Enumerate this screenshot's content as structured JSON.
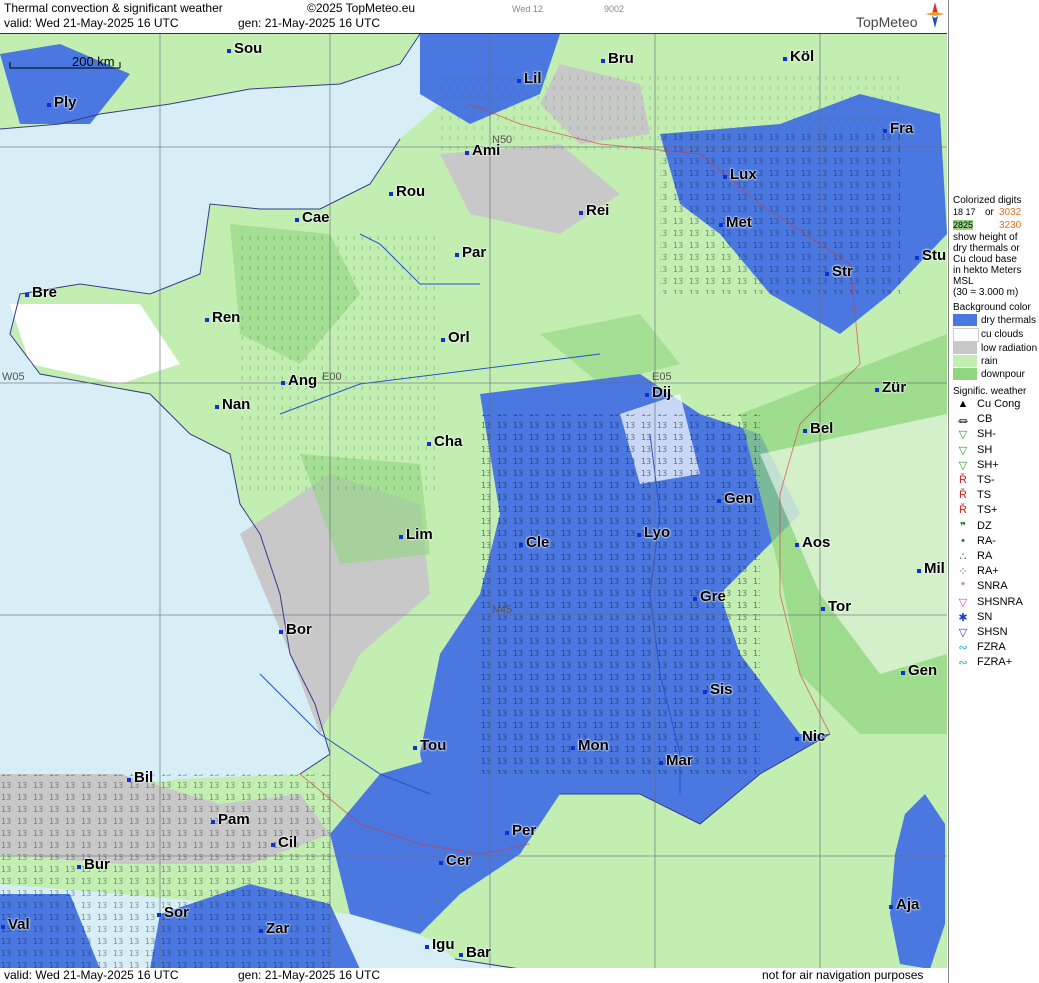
{
  "header": {
    "title": "Thermal convection & significant weather",
    "copyright": "©2025 TopMeteo.eu",
    "valid": "valid:  Wed  21-May-2025  16 UTC",
    "gen": "gen: 21-May-2025 16 UTC",
    "run": "Wed 12",
    "code": "9002",
    "logo": "TopMeteo"
  },
  "footer": {
    "valid": "valid:  Wed  21-May-2025  16 UTC",
    "gen": "gen: 21-May-2025 16 UTC",
    "disclaimer": "not for air navigation purposes"
  },
  "map": {
    "scale": "200 km",
    "grid_labels": [
      "W05",
      "E00",
      "E05",
      "N50",
      "N45"
    ],
    "cities": [
      "Sou",
      "Bru",
      "Köl",
      "Lil",
      "Ply",
      "Ami",
      "Fra",
      "Lux",
      "Rou",
      "Rei",
      "Cae",
      "Met",
      "Par",
      "Stu",
      "Str",
      "Bre",
      "Ren",
      "Orl",
      "Zür",
      "Ang",
      "Dij",
      "Nan",
      "Bel",
      "Cha",
      "Gen",
      "Lim",
      "Lyo",
      "Cle",
      "Aos",
      "Mil",
      "Gre",
      "Tor",
      "Bor",
      "Gen",
      "Sis",
      "Nic",
      "Tou",
      "Mon",
      "Mar",
      "Bil",
      "Pam",
      "Per",
      "Cil",
      "Cer",
      "Bur",
      "Sor",
      "Val",
      "Zar",
      "Aja",
      "Igu",
      "Bar"
    ]
  },
  "legend": {
    "colorized_title": "Colorized digits",
    "or": "or",
    "sample_digits": [
      "18 17",
      "3032",
      "2825",
      "3230"
    ],
    "explanation": [
      "show height of",
      "dry thermals or",
      "Cu cloud base",
      "in hekto Meters",
      "MSL",
      "(30 = 3.000 m)"
    ],
    "background_title": "Background color",
    "backgrounds": [
      {
        "label": "dry thermals",
        "color": "#4a78e0"
      },
      {
        "label": "cu clouds",
        "color": "#ffffff"
      },
      {
        "label": "low radiation",
        "color": "#c8c8c8"
      },
      {
        "label": "rain",
        "color": "#c2eeb2"
      },
      {
        "label": "downpour",
        "color": "#8fd67e"
      }
    ],
    "weather_title": "Signific. weather",
    "weather": [
      {
        "sym": "▲",
        "label": "Cu Cong",
        "color": "#000000"
      },
      {
        "sym": "⏛",
        "label": "CB",
        "color": "#000000"
      },
      {
        "sym": "▽",
        "label": "SH-",
        "color": "#2a9a2a"
      },
      {
        "sym": "▽",
        "label": "SH",
        "color": "#2a9a2a"
      },
      {
        "sym": "▽",
        "label": "SH+",
        "color": "#2a9a2a"
      },
      {
        "sym": "Ř",
        "label": "TS-",
        "color": "#d02020"
      },
      {
        "sym": "Ř",
        "label": "TS",
        "color": "#d02020"
      },
      {
        "sym": "Ř",
        "label": "TS+",
        "color": "#d02020"
      },
      {
        "sym": "❞",
        "label": "DZ",
        "color": "#1a7a1a"
      },
      {
        "sym": "•",
        "label": "RA-",
        "color": "#1a7a1a"
      },
      {
        "sym": "∴",
        "label": "RA",
        "color": "#1a7a1a"
      },
      {
        "sym": "⁘",
        "label": "RA+",
        "color": "#1a7a1a"
      },
      {
        "sym": "*",
        "label": "SNRA",
        "color": "#d040d0"
      },
      {
        "sym": "▽",
        "label": "SHSNRA",
        "color": "#d040d0"
      },
      {
        "sym": "✱",
        "label": "SN",
        "color": "#2040d0"
      },
      {
        "sym": "▽",
        "label": "SHSN",
        "color": "#2040d0"
      },
      {
        "sym": "∾",
        "label": "FZRA",
        "color": "#20b0d0"
      },
      {
        "sym": "∾",
        "label": "FZRA+",
        "color": "#20b0d0"
      }
    ]
  }
}
